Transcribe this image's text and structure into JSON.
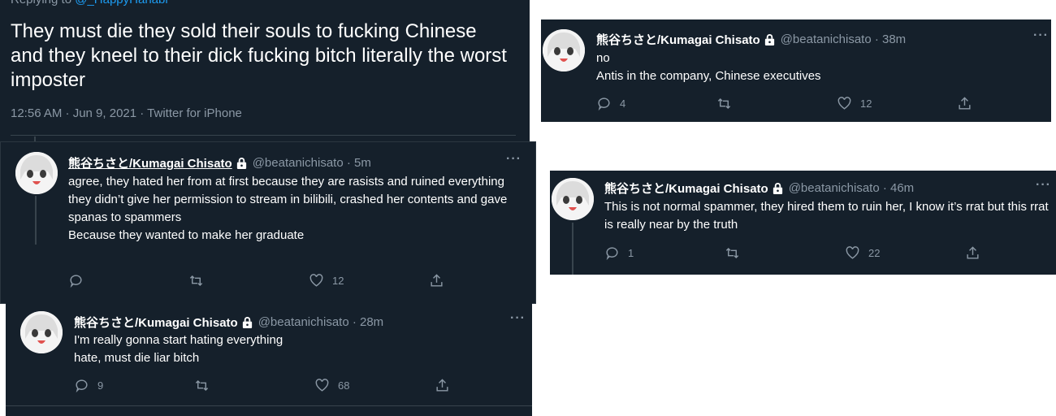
{
  "main_tweet": {
    "replying_prefix": "Replying to ",
    "replying_handle": "@_HappyHanabi",
    "text": "They must die they sold their souls to fucking Chinese and they kneel to their dick fucking bitch literally the worst imposter",
    "meta": "12:56 AM · Jun 9, 2021 · Twitter for iPhone"
  },
  "replies": [
    {
      "name": "熊谷ちさと/Kumagai Chisato",
      "handle_time": "@beatanichisato · 5m",
      "lines": [
        "agree, they hated her from at first because they are rasists and ruined everything",
        "they didn’t give her permission to stream in bilibili, crashed her contents and gave spanas to spammers",
        "Because they wanted to make her graduate"
      ],
      "reply_count": "",
      "retweet_count": "",
      "like_count": "12"
    },
    {
      "name": "熊谷ちさと/Kumagai Chisato",
      "handle_time": "@beatanichisato · 28m",
      "lines": [
        "I'm really gonna start hating everything",
        "hate, must die liar bitch"
      ],
      "reply_count": "9",
      "retweet_count": "",
      "like_count": "68"
    },
    {
      "name": "熊谷ちさと/Kumagai Chisato",
      "handle_time": "@beatanichisato · 38m",
      "lines": [
        "no",
        "Antis in the company, Chinese executives"
      ],
      "reply_count": "4",
      "retweet_count": "",
      "like_count": "12"
    },
    {
      "name": "熊谷ちさと/Kumagai Chisato",
      "handle_time": "@beatanichisato · 46m",
      "lines": [
        "This is not normal spammer, they hired them to ruin her, I know it’s rrat but this rrat is really near by the truth"
      ],
      "reply_count": "1",
      "retweet_count": "",
      "like_count": "22"
    }
  ],
  "icons": {
    "reply": "reply-icon",
    "retweet": "retweet-icon",
    "like": "like-icon",
    "share": "share-icon",
    "lock": "lock-icon",
    "more": "more-icon"
  },
  "colors": {
    "background": "#15202b",
    "text": "#ffffff",
    "muted": "#8b98a5",
    "link": "#1d9bf0",
    "divider": "#38444d"
  }
}
